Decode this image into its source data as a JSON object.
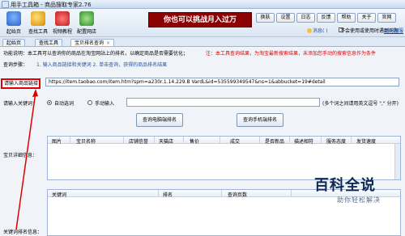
{
  "app": {
    "title": "用手工具箱 - 商品搜取专家2.76"
  },
  "toolbar": {
    "tools": [
      {
        "label": "起始页",
        "icon": "home-icon"
      },
      {
        "label": "查找工具",
        "icon": "find-icon"
      },
      {
        "label": "视频教程",
        "icon": "video-icon"
      },
      {
        "label": "配置网店",
        "icon": "shop-icon"
      }
    ],
    "banner": "你也可以挑战月入过万",
    "buttons_row1": [
      "换肤",
      "设置",
      "日志",
      "反馈",
      "帮助",
      "关于",
      "官网"
    ],
    "message": "消息( )",
    "auto_open_label": "不会使用或使用时遇到问题",
    "settings_link": "联系客服"
  },
  "tabs": [
    {
      "label": "起始页"
    },
    {
      "label": "查找工具"
    },
    {
      "label": "宝贝排名查询"
    }
  ],
  "panel": {
    "desc_label": "功能说明：",
    "desc_text": "本工具可以查询你的商品在淘宝网站上的排名，以确定商品是否需要优化；",
    "desc_note": "注：本工具查询结果，为淘宝最新搜索结果，未添加您手动的搜索信息作为条件",
    "steps_label": "查询步骤：",
    "steps_text": "1. 输入商品链接和关键词 2. 单击查询，获得的商品排名结果",
    "url_label": "请输入商品链接",
    "url_value": "https://item.taobao.com/item.htm?spm=a230r.1.14.229.B VardL&id=535599349547&ns=1&abbucket=19#detail",
    "kw_label": "请输入关键词：",
    "radio_auto": "自动选词",
    "radio_manual": "手动输入",
    "kw_hint": "(多个词之间请用英文逗号 \",\" 分开)",
    "btn_pc": "查询电脑端排名",
    "btn_mobile": "查询手机端排名",
    "detail_label": "宝贝详细信息：",
    "detail_columns": [
      "图片",
      "宝贝名称",
      "店铺信誉",
      "天猫店",
      "售价",
      "成交",
      "是否新品",
      "描述相符",
      "服务态度",
      "发货速度"
    ],
    "kw_rank_label": "关键词排名信息：",
    "kw_columns": [
      "关键词",
      "排名",
      "查询页数"
    ]
  },
  "watermark": {
    "line1": "百科全说",
    "line2": "助你轻松解决"
  }
}
